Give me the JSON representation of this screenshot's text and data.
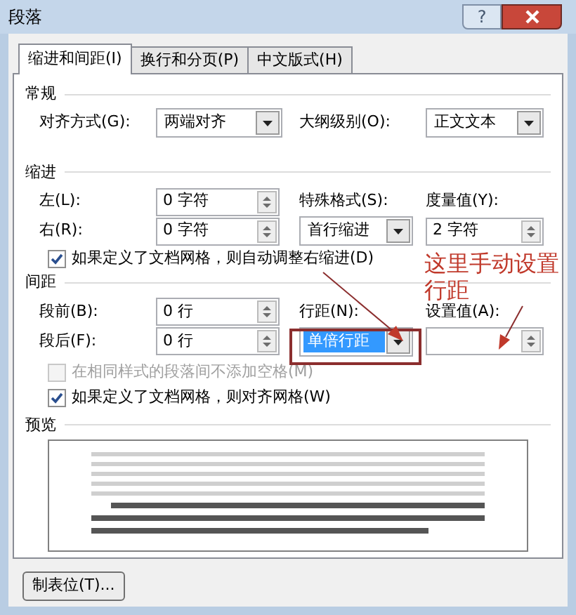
{
  "window": {
    "title": "段落"
  },
  "help_button": {
    "label": "?"
  },
  "tabs": [
    {
      "label": "缩进和间距(I)",
      "selected": true
    },
    {
      "label": "换行和分页(P)",
      "selected": false
    },
    {
      "label": "中文版式(H)",
      "selected": false
    }
  ],
  "general": {
    "title": "常规",
    "alignment": {
      "label": "对齐方式(G):",
      "value": "两端对齐"
    },
    "outline_level": {
      "label": "大纲级别(O):",
      "value": "正文文本"
    }
  },
  "indent": {
    "title": "缩进",
    "left": {
      "label": "左(L):",
      "value": "0 字符"
    },
    "right": {
      "label": "右(R):",
      "value": "0 字符"
    },
    "special": {
      "label": "特殊格式(S):",
      "value": "首行缩进"
    },
    "by": {
      "label": "度量值(Y):",
      "value": "2 字符"
    },
    "auto_adjust": {
      "label": "如果定义了文档网格，则自动调整右缩进(D)",
      "checked": true,
      "disabled": false
    }
  },
  "spacing": {
    "title": "间距",
    "before": {
      "label": "段前(B):",
      "value": "0 行"
    },
    "after": {
      "label": "段后(F):",
      "value": "0 行"
    },
    "line_spacing": {
      "label": "行距(N):",
      "value": "单倍行距",
      "selected": true
    },
    "at": {
      "label": "设置值(A):"
    },
    "no_space_same_style": {
      "label": "在相同样式的段落间不添加空格(M)",
      "checked": false,
      "disabled": true
    },
    "snap_to_grid": {
      "label": "如果定义了文档网格，则对齐网格(W)",
      "checked": true,
      "disabled": false
    }
  },
  "preview": {
    "title": "预览"
  },
  "buttons": [
    {
      "label": "制表位(T)..."
    }
  ],
  "annotation": {
    "text": "这里手动设置行距"
  }
}
